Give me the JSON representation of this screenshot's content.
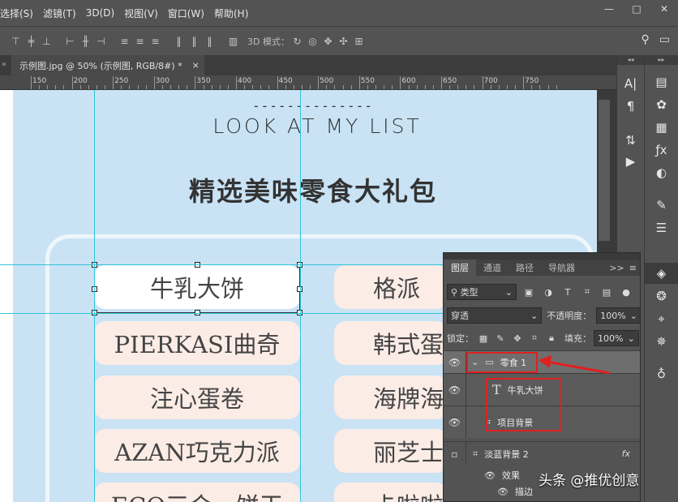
{
  "menu": [
    "选择(S)",
    "滤镜(T)",
    "3D(D)",
    "视图(V)",
    "窗口(W)",
    "帮助(H)"
  ],
  "window_controls": {
    "minimize": "—",
    "maximize": "□",
    "close": "✕"
  },
  "options_bar": {
    "mode_3d": "3D 模式："
  },
  "tab": {
    "title": "示例图.jpg @ 50% (示例图, RGB/8#) *",
    "close": "×"
  },
  "ruler": {
    "ticks": [
      "150",
      "200",
      "250",
      "300",
      "350",
      "400",
      "450",
      "500",
      "550",
      "600",
      "650",
      "700",
      "750"
    ]
  },
  "canvas": {
    "dashes": "--------------",
    "subtitle": "LOOK AT MY LIST",
    "title": "精选美味零食大礼包",
    "left_items": [
      "牛乳大饼",
      "PIERKASI曲奇",
      "注心蛋卷",
      "AZAN巧克力派",
      "ECO三合一饼干"
    ],
    "right_items": [
      "格派",
      "韩式蛋",
      "海牌海",
      "丽芝士",
      "卡啦啦"
    ]
  },
  "layers_panel": {
    "tabs": [
      "图层",
      "通道",
      "路径",
      "导航器"
    ],
    "tab_menu": ">>",
    "filter_kind": "类型",
    "blend_mode": "穿透",
    "opacity_label": "不透明度：",
    "opacity_value": "100%",
    "lock_label": "锁定：",
    "fill_label": "填充：",
    "fill_value": "100%",
    "group_name": "零食 1",
    "text_layer": "牛乳大饼",
    "shape_layer": "项目背景",
    "layer4": "淡蓝背景 2",
    "fx": "fx",
    "effect_label": "效果",
    "stroke_label": "描边"
  },
  "watermark": "头条 @推优创意",
  "colors": {
    "guide": "#31c4d9",
    "highlight": "#e02020",
    "doc_bg": "#c9e3f5",
    "pill": "#fbece6"
  }
}
